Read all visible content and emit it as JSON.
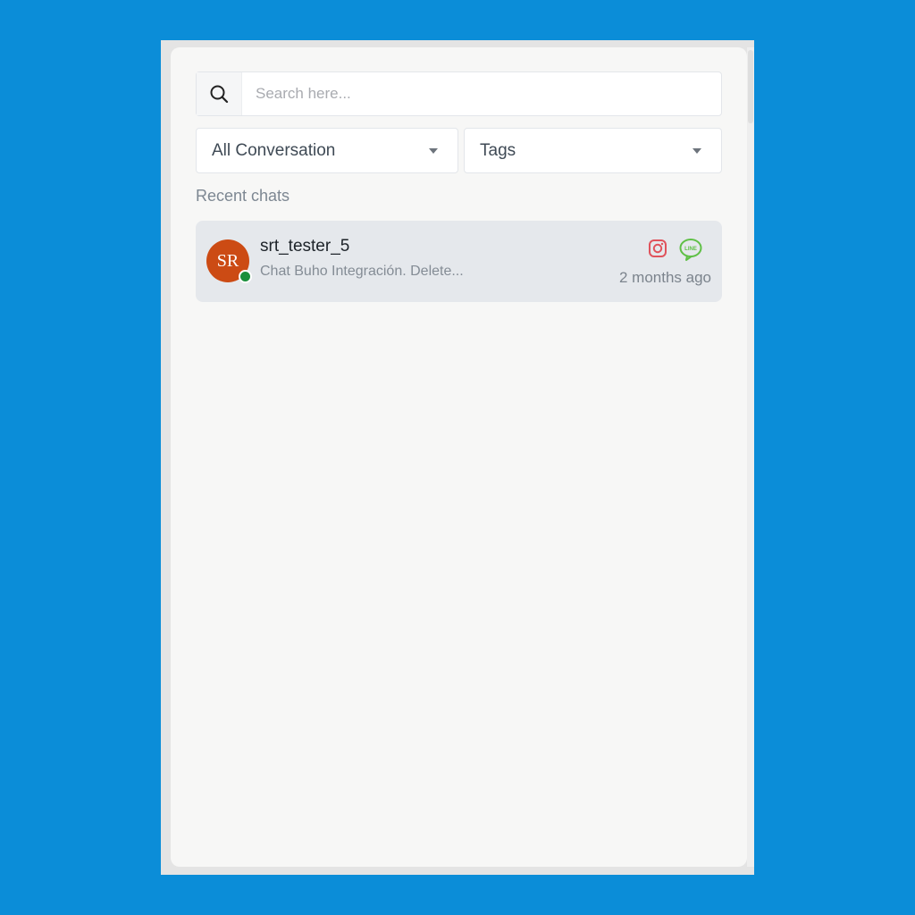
{
  "search": {
    "placeholder": "Search here..."
  },
  "filters": {
    "conversation_label": "All Conversation",
    "tags_label": "Tags"
  },
  "recent_chats_label": "Recent chats",
  "chats": [
    {
      "avatar_initials": "SR",
      "name": "srt_tester_5",
      "preview": "Chat Buho Integración. Delete...",
      "time": "2 months ago",
      "online": true,
      "channel_icons": [
        "instagram-icon",
        "line-icon"
      ],
      "line_icon_text": "LINE"
    }
  ],
  "colors": {
    "background": "#0b8dd8",
    "avatar": "#cc4b14",
    "online_status": "#1a8f3c",
    "instagram": "#e0535c",
    "line": "#5fc046"
  }
}
